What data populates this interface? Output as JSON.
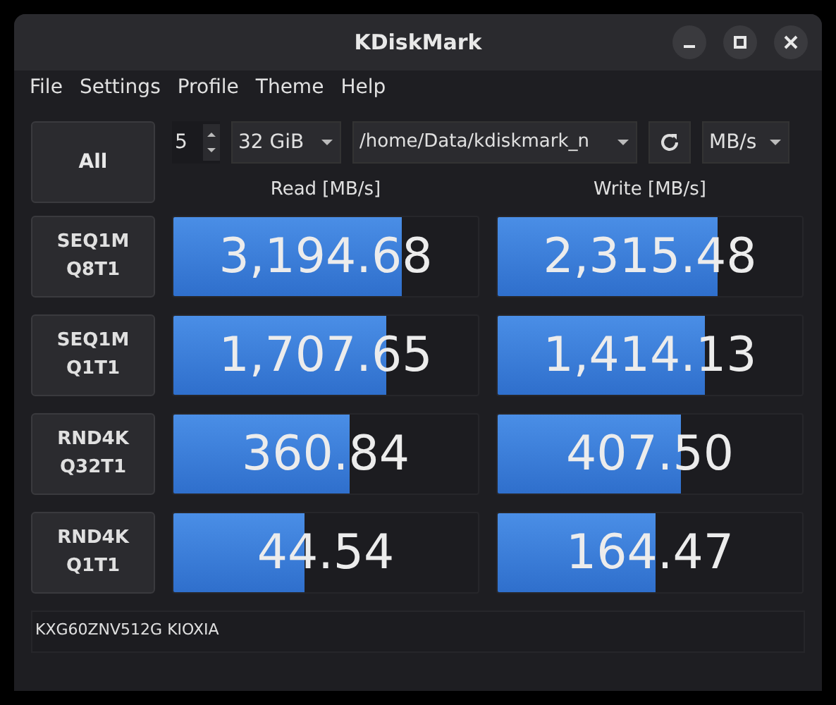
{
  "window": {
    "title": "KDiskMark"
  },
  "menu": [
    "File",
    "Settings",
    "Profile",
    "Theme",
    "Help"
  ],
  "toolbar": {
    "all_button": "All",
    "runs": "5",
    "size": "32 GiB",
    "path": "/home/Data/kdiskmark_n",
    "unit": "MB/s"
  },
  "headers": {
    "read": "Read [MB/s]",
    "write": "Write [MB/s]"
  },
  "tests": [
    {
      "label": "SEQ1M\nQ8T1",
      "read": {
        "value": "3,194.68",
        "level": 0.75
      },
      "write": {
        "value": "2,315.48",
        "level": 0.72
      }
    },
    {
      "label": "SEQ1M\nQ1T1",
      "read": {
        "value": "1,707.65",
        "level": 0.7
      },
      "write": {
        "value": "1,414.13",
        "level": 0.68
      }
    },
    {
      "label": "RND4K\nQ32T1",
      "read": {
        "value": "360.84",
        "level": 0.58
      },
      "write": {
        "value": "407.50",
        "level": 0.6
      }
    },
    {
      "label": "RND4K\nQ1T1",
      "read": {
        "value": "44.54",
        "level": 0.43
      },
      "write": {
        "value": "164.47",
        "level": 0.52
      }
    }
  ],
  "device": "KXG60ZNV512G KIOXIA"
}
